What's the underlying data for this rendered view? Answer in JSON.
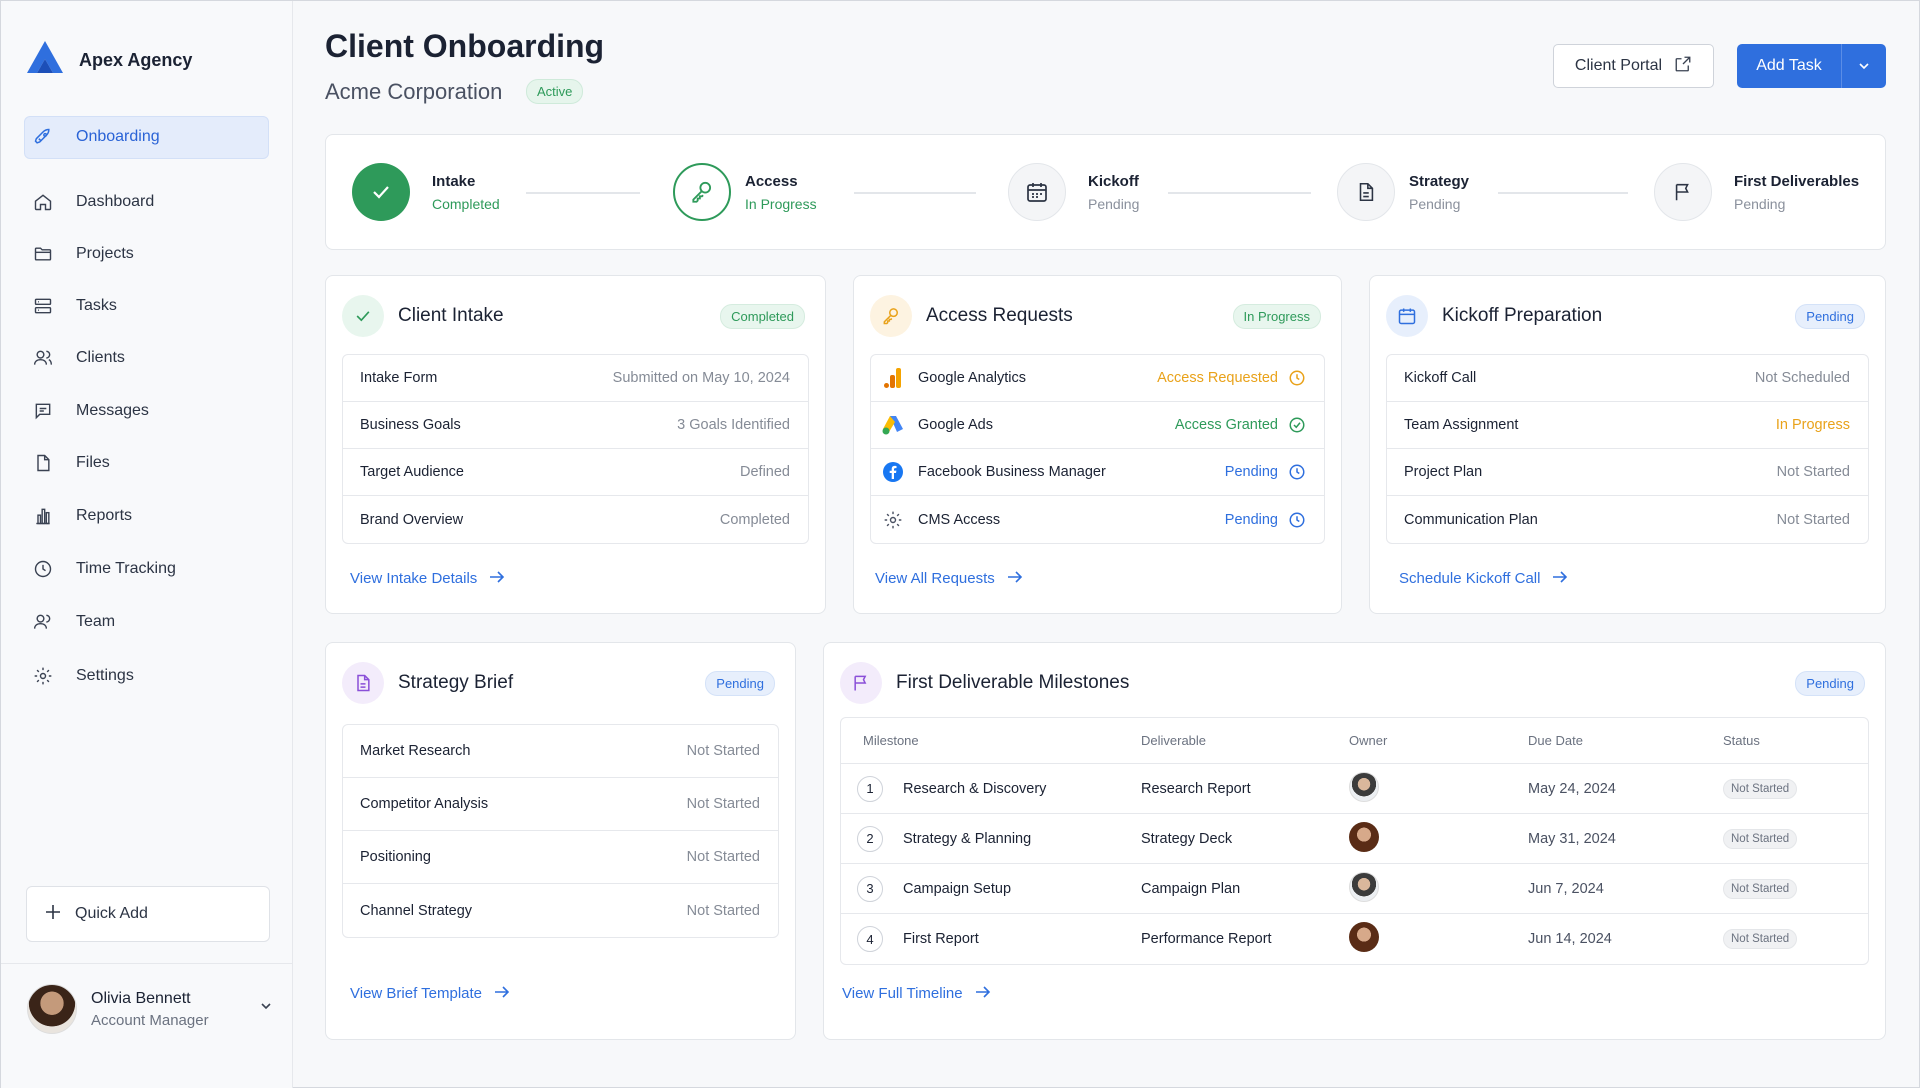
{
  "brand": {
    "name": "Apex Agency"
  },
  "sidebar": {
    "items": [
      {
        "label": "Onboarding",
        "icon": "rocket-icon",
        "active": true
      },
      {
        "label": "Dashboard",
        "icon": "home-icon"
      },
      {
        "label": "Projects",
        "icon": "folder-icon"
      },
      {
        "label": "Tasks",
        "icon": "tasks-icon"
      },
      {
        "label": "Clients",
        "icon": "users-icon"
      },
      {
        "label": "Messages",
        "icon": "message-icon"
      },
      {
        "label": "Files",
        "icon": "file-icon"
      },
      {
        "label": "Reports",
        "icon": "bar-chart-icon"
      },
      {
        "label": "Time Tracking",
        "icon": "clock-icon"
      },
      {
        "label": "Team",
        "icon": "team-icon"
      },
      {
        "label": "Settings",
        "icon": "gear-icon"
      }
    ],
    "quick_add": "Quick Add",
    "user": {
      "name": "Olivia Bennett",
      "role": "Account Manager"
    }
  },
  "header": {
    "title": "Client Onboarding",
    "client": "Acme Corporation",
    "status": "Active",
    "portal_button": "Client Portal",
    "add_button": "Add Task"
  },
  "stepper": [
    {
      "name": "Intake",
      "status": "Completed"
    },
    {
      "name": "Access",
      "status": "In Progress"
    },
    {
      "name": "Kickoff",
      "status": "Pending"
    },
    {
      "name": "Strategy",
      "status": "Pending"
    },
    {
      "name": "First Deliverables",
      "status": "Pending"
    }
  ],
  "intake": {
    "title": "Client Intake",
    "badge": "Completed",
    "rows": [
      {
        "label": "Intake Form",
        "value": "Submitted on May 10, 2024"
      },
      {
        "label": "Business Goals",
        "value": "3 Goals Identified"
      },
      {
        "label": "Target Audience",
        "value": "Defined"
      },
      {
        "label": "Brand Overview",
        "value": "Completed"
      }
    ],
    "link": "View Intake Details"
  },
  "access": {
    "title": "Access Requests",
    "badge": "In Progress",
    "rows": [
      {
        "label": "Google Analytics",
        "value": "Access Requested"
      },
      {
        "label": "Google Ads",
        "value": "Access Granted"
      },
      {
        "label": "Facebook Business Manager",
        "value": "Pending"
      },
      {
        "label": "CMS Access",
        "value": "Pending"
      }
    ],
    "link": "View All Requests"
  },
  "kickoff": {
    "title": "Kickoff Preparation",
    "badge": "Pending",
    "rows": [
      {
        "label": "Kickoff Call",
        "value": "Not Scheduled"
      },
      {
        "label": "Team Assignment",
        "value": "In Progress"
      },
      {
        "label": "Project Plan",
        "value": "Not Started"
      },
      {
        "label": "Communication Plan",
        "value": "Not Started"
      }
    ],
    "link": "Schedule Kickoff Call"
  },
  "strategy": {
    "title": "Strategy Brief",
    "badge": "Pending",
    "rows": [
      {
        "label": "Market Research",
        "value": "Not Started"
      },
      {
        "label": "Competitor Analysis",
        "value": "Not Started"
      },
      {
        "label": "Positioning",
        "value": "Not Started"
      },
      {
        "label": "Channel Strategy",
        "value": "Not Started"
      }
    ],
    "link": "View Brief Template"
  },
  "milestones": {
    "title": "First Deliverable Milestones",
    "badge": "Pending",
    "columns": [
      "Milestone",
      "Deliverable",
      "Owner",
      "Due Date",
      "Status"
    ],
    "rows": [
      {
        "num": "1",
        "milestone": "Research & Discovery",
        "deliverable": "Research Report",
        "due": "May 24, 2024",
        "status": "Not Started"
      },
      {
        "num": "2",
        "milestone": "Strategy & Planning",
        "deliverable": "Strategy Deck",
        "due": "May 31, 2024",
        "status": "Not Started"
      },
      {
        "num": "3",
        "milestone": "Campaign Setup",
        "deliverable": "Campaign Plan",
        "due": "Jun 7, 2024",
        "status": "Not Started"
      },
      {
        "num": "4",
        "milestone": "First Report",
        "deliverable": "Performance Report",
        "due": "Jun 14, 2024",
        "status": "Not Started"
      }
    ],
    "link": "View Full Timeline"
  },
  "colors": {
    "accent": "#2f6fde",
    "success": "#2e9a5a",
    "warning": "#e9a21a"
  }
}
